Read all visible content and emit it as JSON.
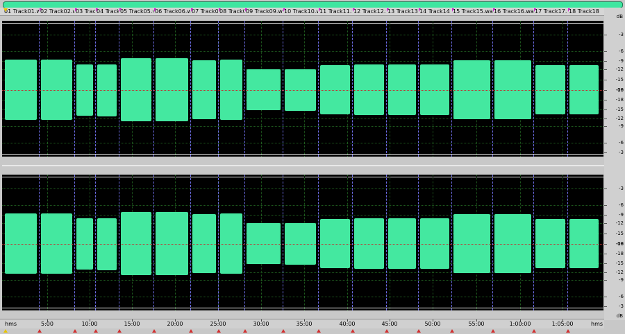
{
  "colors": {
    "waveform": "#44e8a0",
    "background": "#000000",
    "clip_line": "#f0f0f0",
    "grid": "#1e5a1e",
    "center_line": "#c03030",
    "cue_marker": "#d020d0",
    "overview_bar": "#3ee6a0"
  },
  "icons": {
    "cue_marker": "triangle-marker-icon",
    "start_marker": "start-marker-icon"
  },
  "cue_markers": [
    {
      "label": "01 Track01.wav"
    },
    {
      "label": "02 Track02.wav"
    },
    {
      "label": "03 Track03.wav"
    },
    {
      "label": "04 Track04.wav"
    },
    {
      "label": "05 Track05.wav"
    },
    {
      "label": "06 Track06.wav"
    },
    {
      "label": "07 Track07.wav"
    },
    {
      "label": "08 Track08.wav"
    },
    {
      "label": "09 Track09.wav"
    },
    {
      "label": "10 Track10.wav"
    },
    {
      "label": "11 Track11.wav"
    },
    {
      "label": "12 Track12.wav"
    },
    {
      "label": "13 Track13"
    },
    {
      "label": "14 Track14"
    },
    {
      "label": "15 Track15.wav"
    },
    {
      "label": "16 Track16.wav"
    },
    {
      "label": "17 Track17.wav"
    },
    {
      "label": "18 Track18"
    }
  ],
  "time_ruler": {
    "unit_left": "hms",
    "unit_right": "hms",
    "labels": [
      "5:00",
      "10:00",
      "15:00",
      "20:00",
      "25:00",
      "30:00",
      "35:00",
      "40:00",
      "45:00",
      "50:00",
      "55:00",
      "1:00:00",
      "1:05:00"
    ]
  },
  "db_scale": {
    "unit": "dB",
    "labels": [
      "-3",
      "-6",
      "-9",
      "-12",
      "-15",
      "-18",
      "-00",
      "-18",
      "-15",
      "-12",
      "-9",
      "-6",
      "-3"
    ]
  }
}
